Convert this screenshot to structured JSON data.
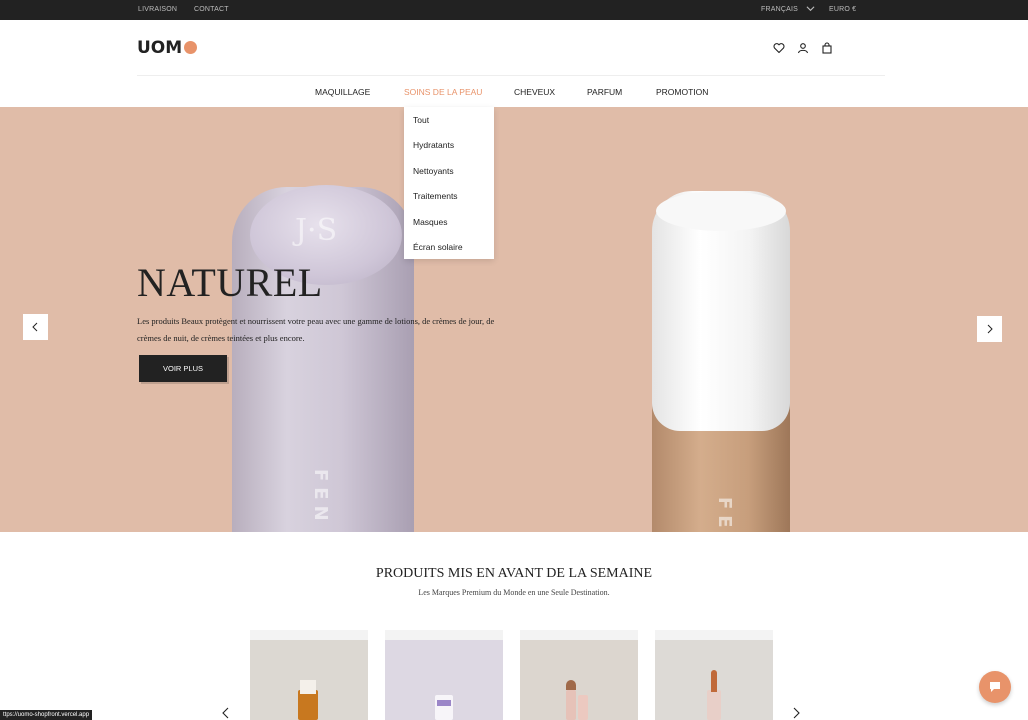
{
  "topbar": {
    "links": [
      "LIVRAISON",
      "CONTACT"
    ],
    "language": "FRANÇAIS",
    "currency": "EURO €"
  },
  "header": {
    "logo": "UOM",
    "icons": [
      "heart-icon",
      "user-icon",
      "bag-icon"
    ]
  },
  "nav": {
    "items": [
      "MAQUILLAGE",
      "SOINS DE LA PEAU",
      "CHEVEUX",
      "PARFUM",
      "PROMOTION"
    ],
    "active": "SOINS DE LA PEAU"
  },
  "dropdown": {
    "items": [
      "Tout",
      "Hydratants",
      "Nettoyants",
      "Traitements",
      "Masques",
      "Écran solaire"
    ]
  },
  "hero": {
    "title": "NATUREL",
    "text": "Les produits Beaux protègent et nourrissent votre peau avec une gamme de lotions, de crèmes de jour, de crèmes de nuit, de crèmes teintées et plus encore.",
    "button": "VOIR PLUS",
    "bg_color": "#e0bca8"
  },
  "featured": {
    "title": "PRODUITS MIS EN AVANT DE LA SEMAINE",
    "subtitle": "Les Marques Premium du Monde en une Seule Destination."
  },
  "status_url": "ttps://uomo-shopfront.vercel.app",
  "colors": {
    "accent": "#e8936a",
    "dark": "#222222"
  }
}
